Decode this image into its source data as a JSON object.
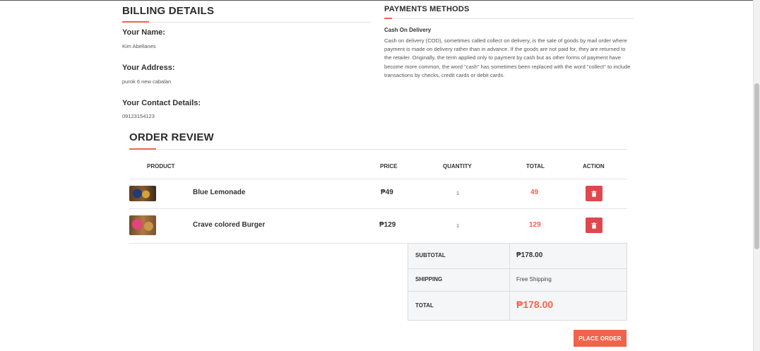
{
  "billing": {
    "title": "BILLING DETAILS",
    "name_label": "Your Name:",
    "name_value": "Kim Abellanes",
    "address_label": "Your Address:",
    "address_value": "purok 6 new cabalan",
    "contact_label": "Your Contact Details:",
    "contact_value": "09123154123"
  },
  "payment": {
    "title": "PAYMENTS METHODS",
    "method_title": "Cash On Delivery",
    "description": "Cash on delivery (COD), sometimes called collect on delivery, is the sale of goods by mail order where payment is made on delivery rather than in advance. If the goods are not paid for, they are returned to the retailer. Originally, the term applied only to payment by cash but as other forms of payment have become more common, the word \"cash\" has sometimes been replaced with the word \"collect\" to include transactions by checks, credit cards or debit cards."
  },
  "order": {
    "title": "ORDER REVIEW",
    "headers": {
      "product": "PRODUCT",
      "price": "PRICE",
      "quantity": "QUANTITY",
      "total": "TOTAL",
      "action": "ACTION"
    },
    "items": [
      {
        "name": "Blue Lemonade",
        "price": "₱49",
        "quantity": "1",
        "total": "49"
      },
      {
        "name": "Crave colored Burger",
        "price": "₱129",
        "quantity": "1",
        "total": "129"
      }
    ],
    "summary": {
      "subtotal_label": "SUBTOTAL",
      "subtotal_value": "₱178.00",
      "shipping_label": "SHIPPING",
      "shipping_value": "Free Shipping",
      "total_label": "TOTAL",
      "total_value": "₱178.00"
    },
    "place_order_label": "PLACE ORDER"
  },
  "colors": {
    "accent": "#f0654a",
    "delete": "#e0474c"
  },
  "icons": {
    "delete": "trash-icon"
  }
}
